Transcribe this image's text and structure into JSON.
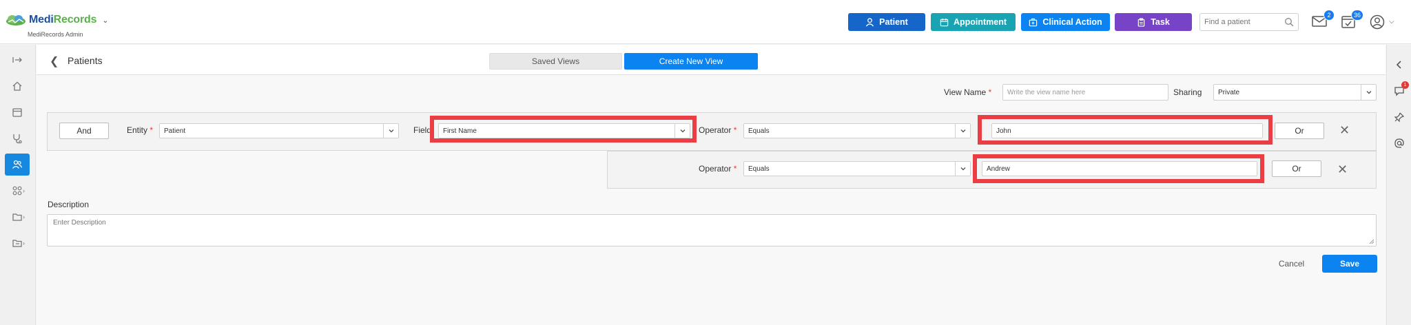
{
  "header": {
    "logo": {
      "part1": "Medi",
      "part2": "Records",
      "subtitle": "MediRecords Admin"
    },
    "buttons": {
      "patient": "Patient",
      "appointment": "Appointment",
      "clinical_action": "Clinical Action",
      "task": "Task"
    },
    "search": {
      "placeholder": "Find a patient"
    },
    "mail_badge": "2",
    "tasks_badge": "36"
  },
  "right_bar": {
    "notifications_badge": "1"
  },
  "page": {
    "title": "Patients",
    "tabs": {
      "saved_views": "Saved Views",
      "create_new_view": "Create New View"
    }
  },
  "form": {
    "view_name": {
      "label": "View Name",
      "placeholder": "Write the view name here"
    },
    "sharing": {
      "label": "Sharing",
      "value": "Private"
    },
    "row1": {
      "logic_button": "And",
      "entity": {
        "label": "Entity",
        "value": "Patient"
      },
      "field": {
        "label": "Field",
        "value": "First Name"
      },
      "operator": {
        "label": "Operator",
        "value": "Equals"
      },
      "value": "John",
      "or_button": "Or"
    },
    "row2": {
      "operator": {
        "label": "Operator",
        "value": "Equals"
      },
      "value": "Andrew",
      "or_button": "Or"
    },
    "description": {
      "label": "Description",
      "placeholder": "Enter Description"
    },
    "actions": {
      "cancel": "Cancel",
      "save": "Save"
    }
  },
  "colors": {
    "primary": "#0b84f2",
    "patient_btn": "#1666c9",
    "appointment_btn": "#1aa3b3",
    "task_btn": "#7744c7",
    "highlight": "#ea3e44",
    "required": "#e53935"
  }
}
